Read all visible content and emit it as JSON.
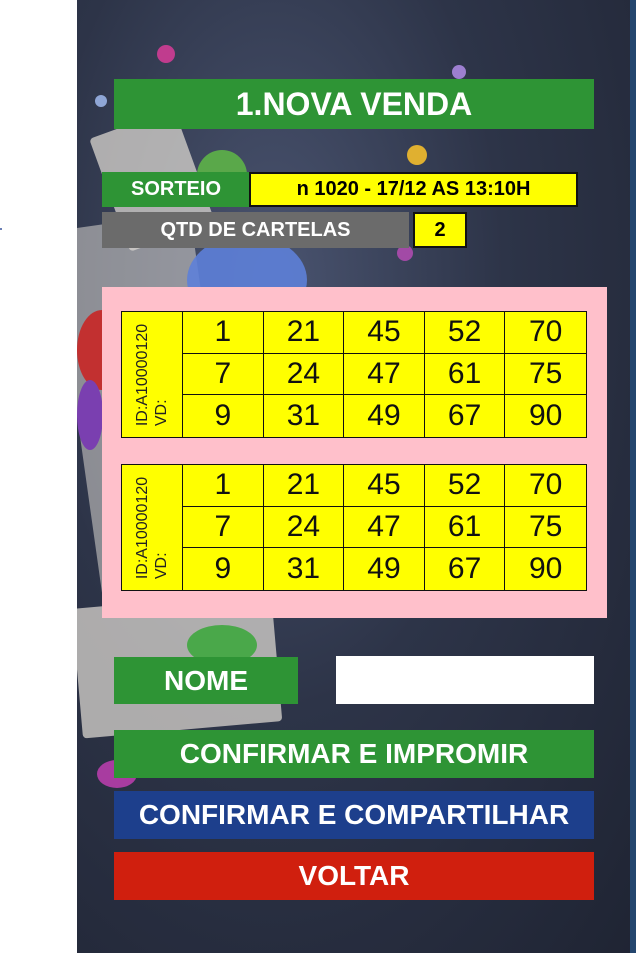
{
  "title": "1.NOVA VENDA",
  "sorteio": {
    "label": "SORTEIO",
    "value": "n 1020 - 17/12 AS 13:10H"
  },
  "qtd": {
    "label": "QTD DE CARTELAS",
    "value": "2"
  },
  "tickets": [
    {
      "id": "ID:A10000120",
      "vd": "VD:",
      "numbers": [
        "1",
        "21",
        "45",
        "52",
        "70",
        "7",
        "24",
        "47",
        "61",
        "75",
        "9",
        "31",
        "49",
        "67",
        "90"
      ]
    },
    {
      "id": "ID:A10000120",
      "vd": "VD:",
      "numbers": [
        "1",
        "21",
        "45",
        "52",
        "70",
        "7",
        "24",
        "47",
        "61",
        "75",
        "9",
        "31",
        "49",
        "67",
        "90"
      ]
    }
  ],
  "nome": {
    "label": "NOME",
    "value": ""
  },
  "buttons": {
    "confirm_print": "CONFIRMAR E IMPROMIR",
    "confirm_share": "CONFIRMAR E COMPARTILHAR",
    "back": "VOLTAR"
  },
  "colors": {
    "green": "#2e9435",
    "blue": "#1d3f8c",
    "red": "#d01f0e",
    "yellow": "#ffff00",
    "pink": "#ffc0cb",
    "gray": "#6b6b6b"
  }
}
